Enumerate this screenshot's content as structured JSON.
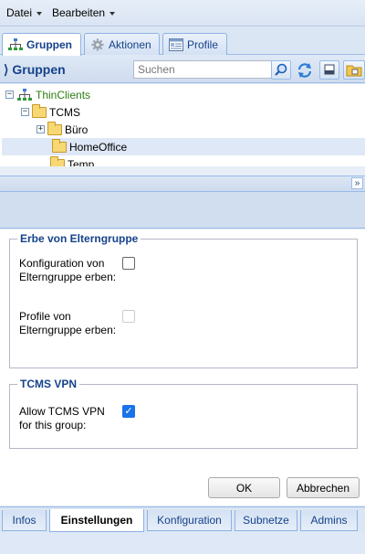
{
  "menu": {
    "file_label": "Datei",
    "edit_label": "Bearbeiten"
  },
  "main_tabs": [
    {
      "label": "Gruppen",
      "icon": "tree-icon",
      "active": true
    },
    {
      "label": "Aktionen",
      "icon": "gear-icon",
      "active": false
    },
    {
      "label": "Profile",
      "icon": "profile-card-icon",
      "active": false
    }
  ],
  "groups_panel": {
    "title": "Gruppen",
    "search": {
      "placeholder": "Suchen",
      "value": ""
    }
  },
  "tree": {
    "root": "ThinClients",
    "child": "TCMS",
    "items": [
      "Büro",
      "HomeOffice",
      "Temp"
    ],
    "selected": "HomeOffice"
  },
  "inherit_section": {
    "legend": "Erbe von Elterngruppe",
    "config_label": "Konfiguration von Elterngruppe erben:",
    "config_checked": false,
    "profiles_label": "Profile von Elterngruppe erben:",
    "profiles_checked": false,
    "profiles_disabled": true
  },
  "vpn_section": {
    "legend": "TCMS VPN",
    "allow_label": "Allow TCMS VPN for this group:",
    "allow_checked": true
  },
  "buttons": {
    "ok": "OK",
    "cancel": "Abbrechen"
  },
  "bottom_tabs": [
    {
      "label": "Infos",
      "active": false
    },
    {
      "label": "Einstellungen",
      "active": true
    },
    {
      "label": "Konfiguration",
      "active": false
    },
    {
      "label": "Subnetze",
      "active": false
    },
    {
      "label": "Admins",
      "active": false
    }
  ],
  "colors": {
    "accent": "#15428b",
    "panel_bg": "#dfe8f6",
    "tree_root_text": "#2e7d12",
    "checkbox_on": "#1a73e8"
  }
}
